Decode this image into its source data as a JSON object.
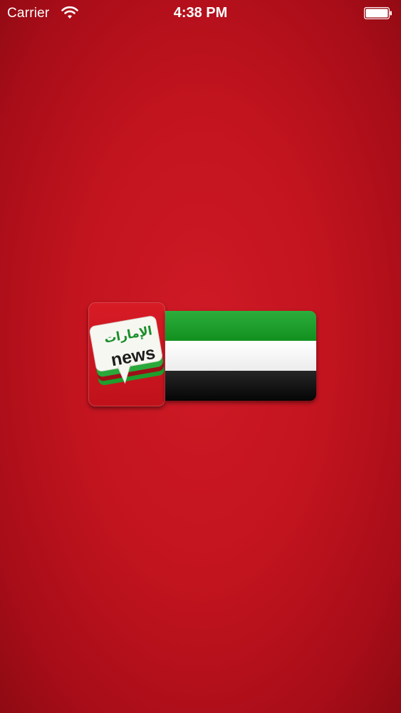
{
  "status_bar": {
    "carrier": "Carrier",
    "time": "4:38 PM",
    "wifi_icon": "wifi-icon",
    "battery_icon": "battery-full-icon",
    "text_color": "#ffffff"
  },
  "splash": {
    "background_color": "#c2141f",
    "app_icon": {
      "arabic_text": "الإمارات",
      "english_text": "news",
      "icon_name": "speech-bubble-icon"
    },
    "flag": {
      "name": "uae-flag",
      "stripe_colors": [
        "#1e9e2c",
        "#ffffff",
        "#0d0d0d"
      ]
    }
  }
}
